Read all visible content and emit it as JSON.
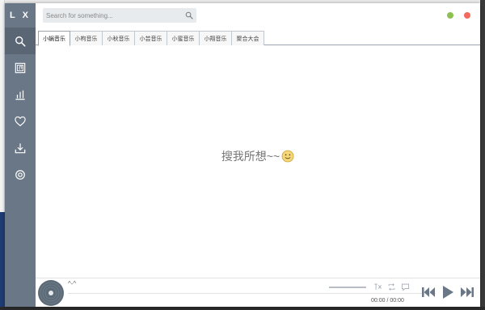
{
  "app": {
    "logo": "L X",
    "colors": {
      "sidebar": "#6a7786",
      "sidebar_active": "#5a6674",
      "dot_green": "#8cc152",
      "dot_red": "#f26b5b",
      "icon": "#8a96a3"
    }
  },
  "sidebar": {
    "items": [
      {
        "icon": "search-icon",
        "active": true
      },
      {
        "icon": "music-library-icon",
        "active": false
      },
      {
        "icon": "chart-icon",
        "active": false
      },
      {
        "icon": "heart-icon",
        "active": false
      },
      {
        "icon": "download-icon",
        "active": false
      },
      {
        "icon": "settings-icon",
        "active": false
      }
    ]
  },
  "search": {
    "placeholder": "Search for something..."
  },
  "tabs": [
    {
      "label": "小蜗音乐",
      "active": true
    },
    {
      "label": "小枸音乐",
      "active": false
    },
    {
      "label": "小秋音乐",
      "active": false
    },
    {
      "label": "小芸音乐",
      "active": false
    },
    {
      "label": "小蜜音乐",
      "active": false
    },
    {
      "label": "小翔音乐",
      "active": false
    },
    {
      "label": "聚合大会",
      "active": false
    }
  ],
  "content": {
    "empty_message": "搜我所想~~"
  },
  "player": {
    "song_title": "^-^",
    "current_time": "00:00",
    "separator": "/",
    "total_time": "00:00",
    "progress": 0
  }
}
